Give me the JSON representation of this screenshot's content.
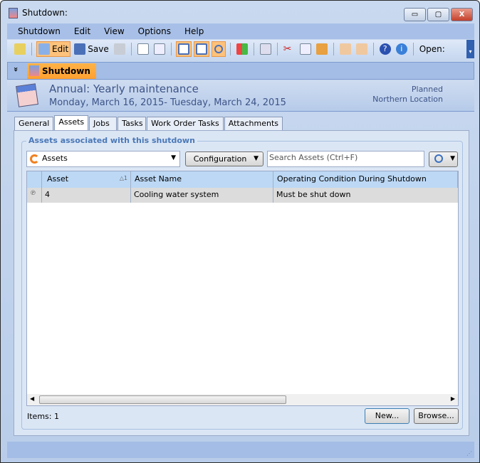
{
  "window": {
    "title": "Shutdown:",
    "minimize": "▭",
    "maximize": "▢",
    "close": "X"
  },
  "menu": [
    "Shutdown",
    "Edit",
    "View",
    "Options",
    "Help"
  ],
  "toolbar": {
    "edit": "Edit",
    "save": "Save",
    "open": "Open:"
  },
  "header": {
    "tab": "Shutdown",
    "collapse": "»"
  },
  "info": {
    "title": "Annual: Yearly maintenance",
    "dates": "Monday, March 16, 2015- Tuesday, March 24, 2015",
    "status": "Planned",
    "location": "Northern Location"
  },
  "tabs": [
    "General",
    "Assets",
    "Jobs",
    "Tasks",
    "Work Order Tasks",
    "Attachments"
  ],
  "group": {
    "label": "Assets associated with this shutdown",
    "view_select": "Assets",
    "configuration": "Configuration",
    "search_placeholder": "Search Assets  (Ctrl+F)"
  },
  "grid": {
    "columns": [
      "Asset",
      "Asset Name",
      "Operating Condition During Shutdown"
    ],
    "sort_indicator": "△1",
    "rows": [
      {
        "asset": "4",
        "name": "Cooling water system",
        "condition": "Must be shut down"
      }
    ]
  },
  "footer": {
    "items": "Items: 1",
    "new": "New...",
    "browse": "Browse..."
  }
}
